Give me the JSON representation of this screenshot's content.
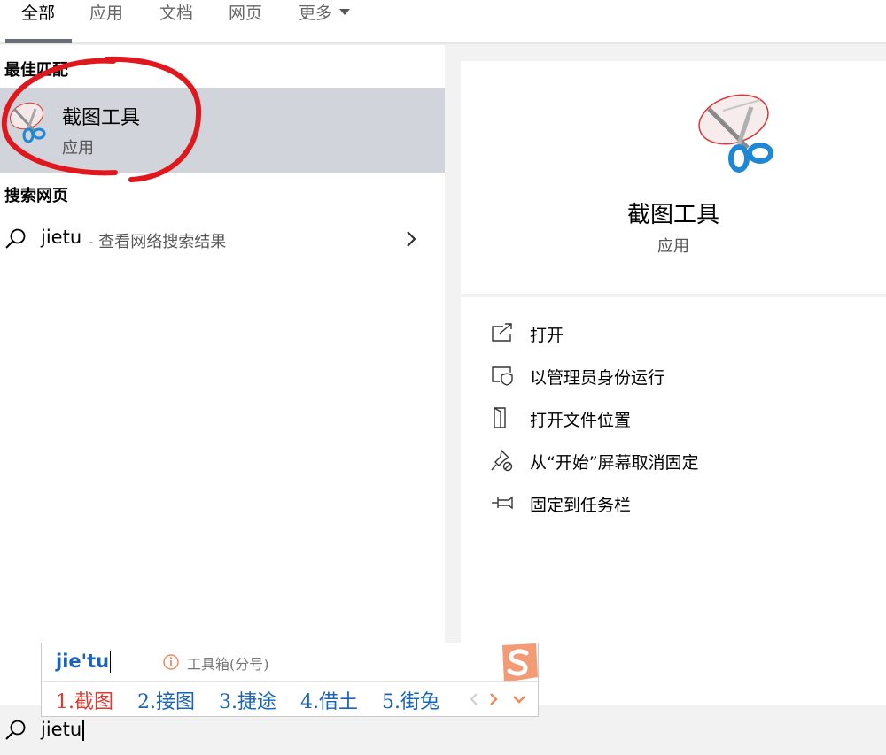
{
  "tabs": {
    "items": [
      {
        "label": "全部",
        "active": true
      },
      {
        "label": "应用",
        "active": false
      },
      {
        "label": "文档",
        "active": false
      },
      {
        "label": "网页",
        "active": false
      },
      {
        "label": "更多",
        "active": false
      }
    ]
  },
  "left": {
    "best_match_title": "最佳匹配",
    "best_match": {
      "title": "截图工具",
      "subtitle": "应用",
      "icon": "snipping-tool-icon"
    },
    "web_title": "搜索网页",
    "web_result": {
      "query": "jietu",
      "description": "- 查看网络搜索结果"
    }
  },
  "detail": {
    "title": "截图工具",
    "subtitle": "应用",
    "actions": [
      {
        "label": "打开",
        "icon": "open-icon"
      },
      {
        "label": "以管理员身份运行",
        "icon": "run-as-admin-icon"
      },
      {
        "label": "打开文件位置",
        "icon": "file-location-icon"
      },
      {
        "label": "从“开始”屏幕取消固定",
        "icon": "unpin-icon"
      },
      {
        "label": "固定到任务栏",
        "icon": "pin-taskbar-icon"
      }
    ]
  },
  "ime": {
    "composition": "jie'tu",
    "hint": "工具箱(分号)",
    "candidates": [
      "1.截图",
      "2.接图",
      "3.捷途",
      "4.借土",
      "5.街兔"
    ]
  },
  "searchbar": {
    "value": "jietu"
  },
  "colors": {
    "selected_bg": "#d1d4da",
    "annotation_red": "#e0181d",
    "ime_blue": "#1a63b8",
    "ime_red": "#e03a2e",
    "sogou_orange": "#f08a5d"
  }
}
